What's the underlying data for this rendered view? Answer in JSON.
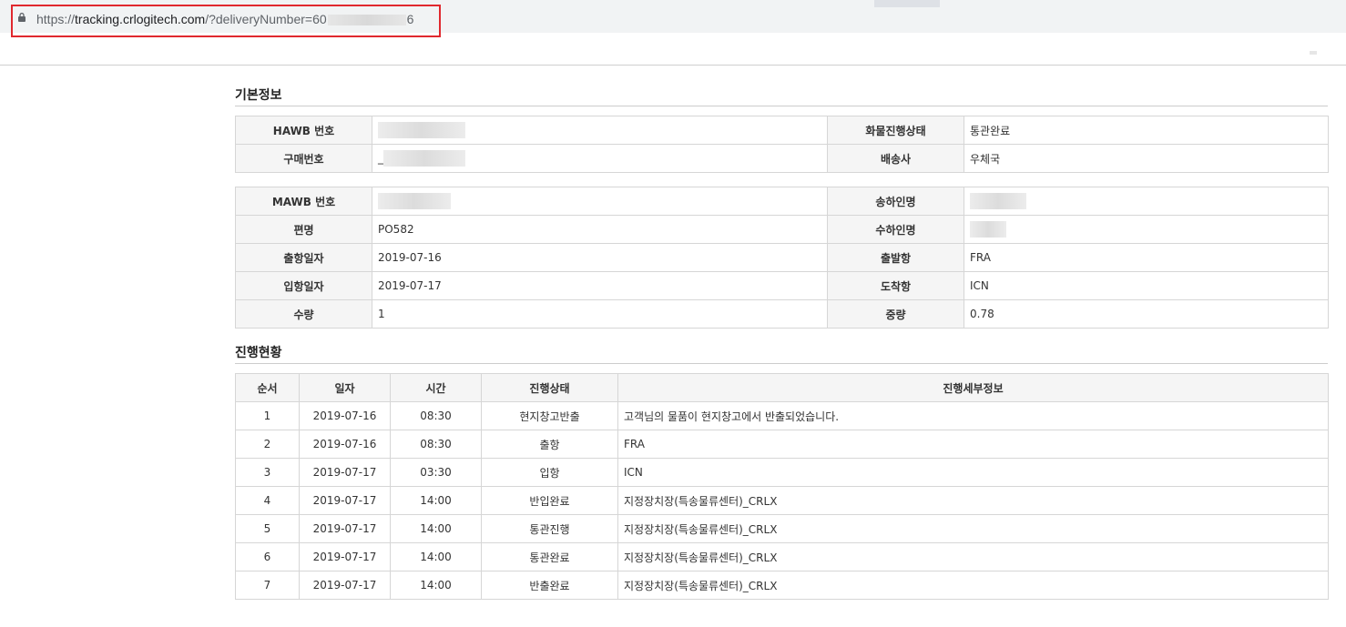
{
  "browser": {
    "url_prefix": "https://",
    "url_host": "tracking.crlogitech.com",
    "url_path_start": "/?deliveryNumber=60",
    "url_path_end": "6"
  },
  "basic_info": {
    "title": "기본정보",
    "hawb_label": "HAWB 번호",
    "purchase_label": "구매번호",
    "purchase_value_visible": "_",
    "cargo_status_label": "화물진행상태",
    "cargo_status_value": "통관완료",
    "carrier_label": "배송사",
    "carrier_value": "우체국",
    "mawb_label": "MAWB 번호",
    "shipper_label": "송하인명",
    "flight_label": "편명",
    "flight_value": "PO582",
    "consignee_label": "수하인명",
    "departure_date_label": "출항일자",
    "departure_date_value": "2019-07-16",
    "origin_label": "출발항",
    "origin_value": "FRA",
    "arrival_date_label": "입항일자",
    "arrival_date_value": "2019-07-17",
    "destination_label": "도착항",
    "destination_value": "ICN",
    "quantity_label": "수량",
    "quantity_value": "1",
    "weight_label": "중량",
    "weight_value": "0.78"
  },
  "progress": {
    "title": "진행현황",
    "columns": [
      "순서",
      "일자",
      "시간",
      "진행상태",
      "진행세부정보"
    ],
    "rows": [
      {
        "no": "1",
        "date": "2019-07-16",
        "time": "08:30",
        "status": "현지창고반출",
        "detail": "고객님의 물품이 현지창고에서 반출되었습니다."
      },
      {
        "no": "2",
        "date": "2019-07-16",
        "time": "08:30",
        "status": "출항",
        "detail": "FRA"
      },
      {
        "no": "3",
        "date": "2019-07-17",
        "time": "03:30",
        "status": "입항",
        "detail": "ICN"
      },
      {
        "no": "4",
        "date": "2019-07-17",
        "time": "14:00",
        "status": "반입완료",
        "detail": "지정장치장(특송물류센터)_CRLX"
      },
      {
        "no": "5",
        "date": "2019-07-17",
        "time": "14:00",
        "status": "통관진행",
        "detail": "지정장치장(특송물류센터)_CRLX"
      },
      {
        "no": "6",
        "date": "2019-07-17",
        "time": "14:00",
        "status": "통관완료",
        "detail": "지정장치장(특송물류센터)_CRLX"
      },
      {
        "no": "7",
        "date": "2019-07-17",
        "time": "14:00",
        "status": "반출완료",
        "detail": "지정장치장(특송물류센터)_CRLX"
      }
    ]
  }
}
